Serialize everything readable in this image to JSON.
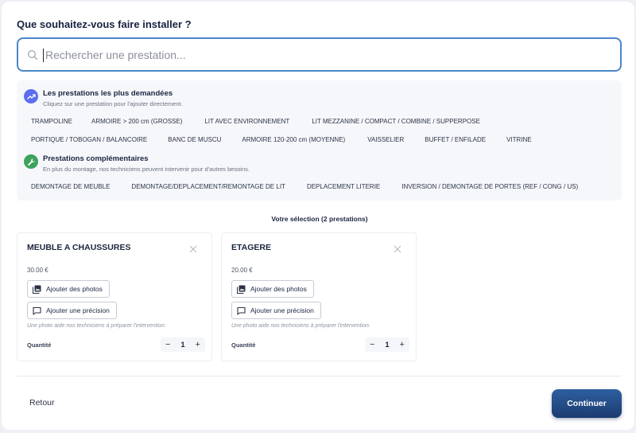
{
  "question": "Que souhaitez-vous faire installer ?",
  "search": {
    "placeholder": "Rechercher une prestation..."
  },
  "popular": {
    "title": "Les prestations les plus demandées",
    "subtitle": "Cliquez sur une prestation pour l'ajouter directement.",
    "chips_row1": [
      "TRAMPOLINE",
      "ARMOIRE > 200 cm (GROSSE)",
      "LIT AVEC ENVIRONNEMENT",
      "LIT MEZZANINE / COMPACT / COMBINE / SUPPERPOSE"
    ],
    "chips_row2": [
      "PORTIQUE / TOBOGAN / BALANCOIRE",
      "BANC DE MUSCU",
      "ARMOIRE 120-200 cm (MOYENNE)",
      "VAISSELIER",
      "BUFFET / ENFILADE",
      "VITRINE"
    ]
  },
  "complementary": {
    "title": "Prestations complémentaires",
    "subtitle": "En plus du montage, nos techniciens peuvent intervenir pour d'autres besoins.",
    "chips": [
      "DEMONTAGE DE MEUBLE",
      "DEMONTAGE/DEPLACEMENT/REMONTAGE DE LIT",
      "DEPLACEMENT LITERIE",
      "INVERSION / DEMONTAGE DE PORTES (REF / CONG / US)"
    ]
  },
  "selection": {
    "title": "Votre sélection (2 prestations)",
    "items": [
      {
        "name": "MEUBLE A CHAUSSURES",
        "price": "30.00 €",
        "add_photos": "Ajouter des photos",
        "add_precision": "Ajouter une précision",
        "hint": "Une photo aide nos techniciens à préparer l'intervention.",
        "qty_label": "Quantité",
        "qty": "1"
      },
      {
        "name": "ETAGERE",
        "price": "20.00 €",
        "add_photos": "Ajouter des photos",
        "add_precision": "Ajouter une précision",
        "hint": "Une photo aide nos techniciens à préparer l'intervention.",
        "qty_label": "Quantité",
        "qty": "1"
      }
    ]
  },
  "footer": {
    "back": "Retour",
    "continue": "Continuer"
  },
  "colors": {
    "accent": "#4a86c8",
    "primary_button": "#24497f",
    "popular_icon": "#5b6ef0",
    "complementary_icon": "#3da35d"
  },
  "icons": {
    "search": "search-icon",
    "popular": "trending-up-icon",
    "complementary": "wrench-icon",
    "photo": "image-icon",
    "comment": "comment-icon",
    "close": "close-icon"
  }
}
